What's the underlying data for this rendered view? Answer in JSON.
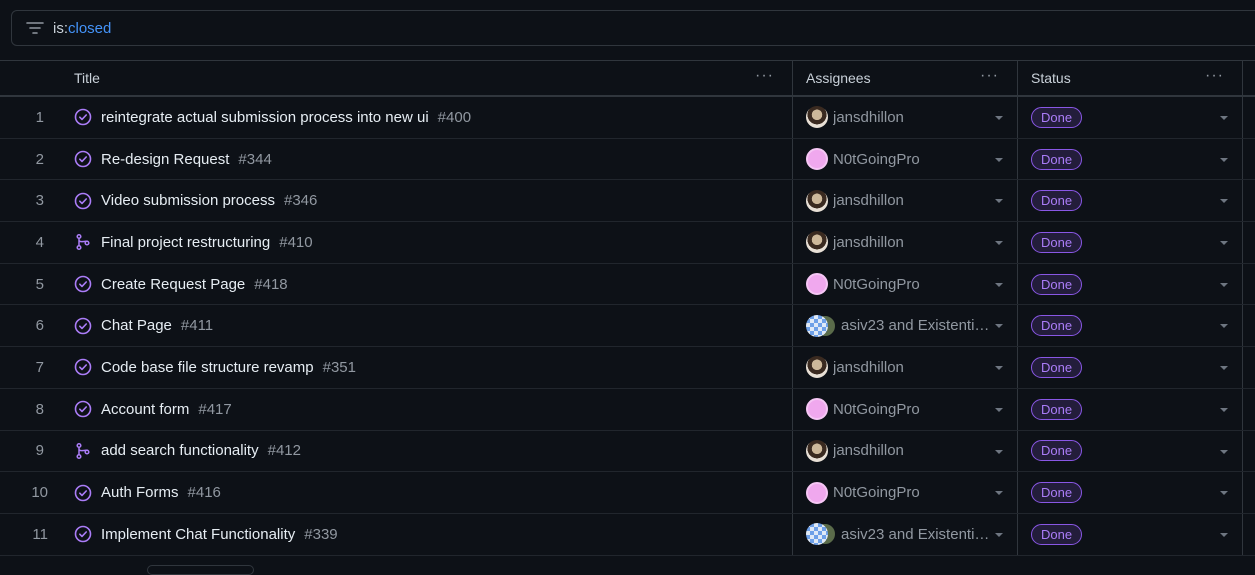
{
  "filter": {
    "prefix": "is:",
    "value": "closed"
  },
  "columns": {
    "title": "Title",
    "assignees": "Assignees",
    "status": "Status",
    "menu": "···"
  },
  "rows": [
    {
      "num": "1",
      "type": "issue",
      "title": "reintegrate actual submission process into new ui",
      "ref": "#400",
      "assignee": "jansdhillon",
      "avatar": "jd",
      "status": "Done"
    },
    {
      "num": "2",
      "type": "issue",
      "title": "Re-design Request",
      "ref": "#344",
      "assignee": "N0tGoingPro",
      "avatar": "np",
      "status": "Done"
    },
    {
      "num": "3",
      "type": "issue",
      "title": "Video submission process",
      "ref": "#346",
      "assignee": "jansdhillon",
      "avatar": "jd",
      "status": "Done"
    },
    {
      "num": "4",
      "type": "pr",
      "title": "Final project restructuring",
      "ref": "#410",
      "assignee": "jansdhillon",
      "avatar": "jd",
      "status": "Done"
    },
    {
      "num": "5",
      "type": "issue",
      "title": "Create Request Page",
      "ref": "#418",
      "assignee": "N0tGoingPro",
      "avatar": "np",
      "status": "Done"
    },
    {
      "num": "6",
      "type": "issue",
      "title": "Chat Page",
      "ref": "#411",
      "assignee": "asiv23 and Existenti…",
      "avatar": "multi",
      "status": "Done"
    },
    {
      "num": "7",
      "type": "issue",
      "title": "Code base file structure revamp",
      "ref": "#351",
      "assignee": "jansdhillon",
      "avatar": "jd",
      "status": "Done"
    },
    {
      "num": "8",
      "type": "issue",
      "title": "Account form",
      "ref": "#417",
      "assignee": "N0tGoingPro",
      "avatar": "np",
      "status": "Done"
    },
    {
      "num": "9",
      "type": "pr",
      "title": "add search functionality",
      "ref": "#412",
      "assignee": "jansdhillon",
      "avatar": "jd",
      "status": "Done"
    },
    {
      "num": "10",
      "type": "issue",
      "title": "Auth Forms",
      "ref": "#416",
      "assignee": "N0tGoingPro",
      "avatar": "np",
      "status": "Done"
    },
    {
      "num": "11",
      "type": "issue",
      "title": "Implement Chat Functionality",
      "ref": "#339",
      "assignee": "asiv23 and Existenti…",
      "avatar": "multi",
      "status": "Done"
    }
  ]
}
